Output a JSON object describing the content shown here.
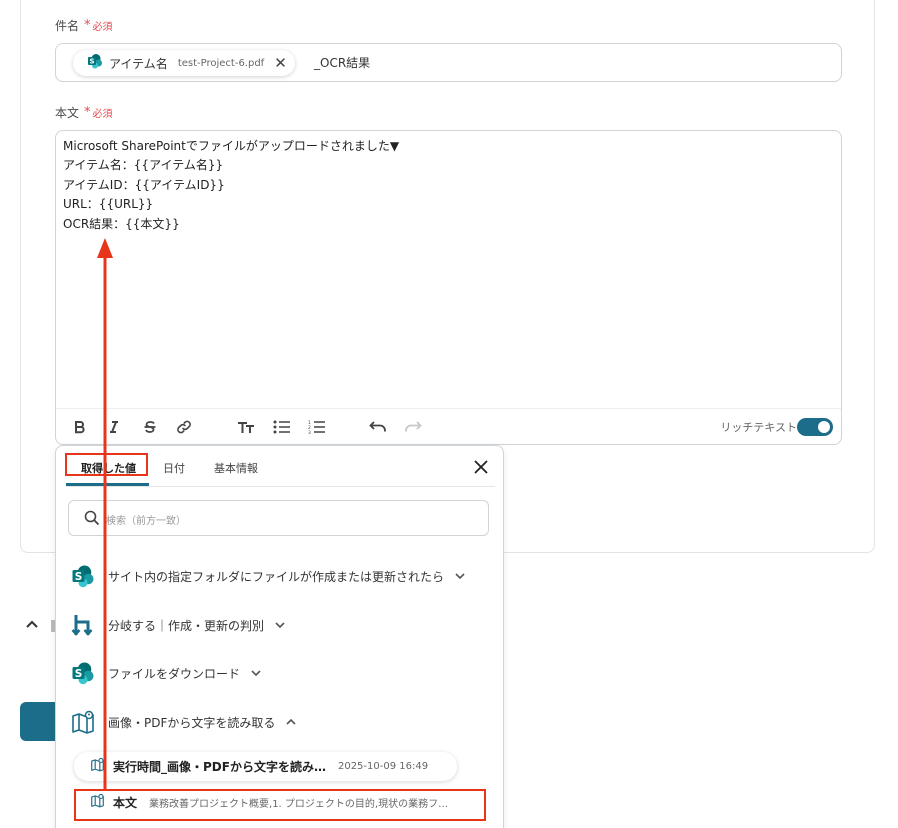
{
  "subject": {
    "label": "件名",
    "required_star": "*",
    "required_text": "必須",
    "chip": {
      "name": "アイテム名",
      "value": "test-Project-6.pdf"
    },
    "suffix_text": "_OCR結果"
  },
  "body": {
    "label": "本文",
    "required_star": "*",
    "required_text": "必須",
    "lines": [
      "Microsoft SharePointでファイルがアップロードされました▼",
      "アイテム名：{{アイテム名}}",
      "アイテムID：{{アイテムID}}",
      "URL：{{URL}}",
      "OCR結果：{{本文}}"
    ],
    "rich_text_label": "リッチテキスト"
  },
  "toolbar_icons": [
    "bold-icon",
    "italic-icon",
    "strikethrough-icon",
    "link-icon",
    "text-size-icon",
    "bullet-list-icon",
    "numbered-list-icon",
    "undo-icon",
    "redo-icon"
  ],
  "popup": {
    "tabs": [
      {
        "label": "取得した値",
        "active": true
      },
      {
        "label": "日付",
        "active": false
      },
      {
        "label": "基本情報",
        "active": false
      }
    ],
    "search_placeholder": "検索（前方一致）",
    "steps": [
      {
        "label": "サイト内の指定フォルダにファイルが作成または更新されたら",
        "icon": "sharepoint-icon",
        "expanded": false
      },
      {
        "label": "分岐する｜作成・更新の判別",
        "icon": "branch-icon",
        "expanded": false
      },
      {
        "label": "ファイルをダウンロード",
        "icon": "sharepoint-icon",
        "expanded": false
      },
      {
        "label": "画像・PDFから文字を読み取る",
        "icon": "ocr-icon",
        "expanded": true
      }
    ],
    "values": [
      {
        "name": "実行時間_画像・PDFから文字を読み…",
        "meta": "2025-10-09 16:49"
      },
      {
        "name": "本文",
        "meta": "業務改善プロジェクト概要,1. プロジェクトの目的,現状の業務フ…"
      }
    ]
  },
  "colors": {
    "accent": "#1c6d8a",
    "required": "#e5484d",
    "annotation": "#e8351a",
    "sharepoint": "#0b8a8f"
  }
}
